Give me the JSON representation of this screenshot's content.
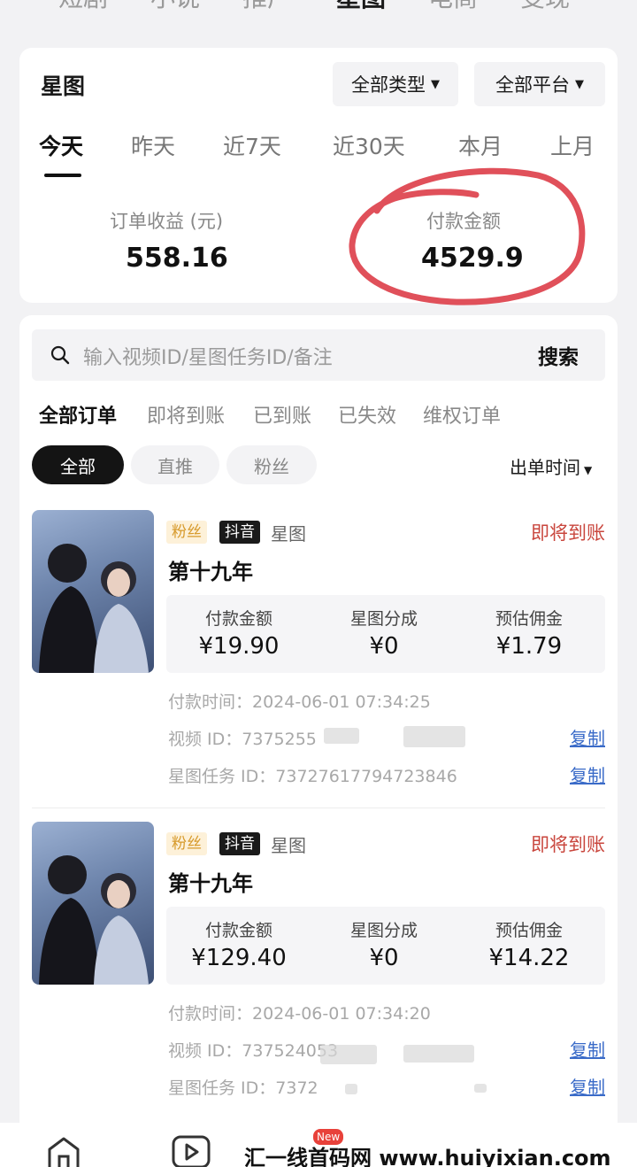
{
  "top_tabs": [
    "短剧",
    "小说",
    "推广",
    "星图",
    "电商",
    "变现"
  ],
  "summary": {
    "title": "星图",
    "filter_type": "全部类型",
    "filter_platform": "全部平台",
    "periods": [
      "今天",
      "昨天",
      "近7天",
      "近30天",
      "本月",
      "上月"
    ],
    "order_income_label": "订单收益 (元)",
    "order_income_value": "558.16",
    "paid_amount_label": "付款金额",
    "paid_amount_value": "4529.9"
  },
  "search": {
    "placeholder": "输入视频ID/星图任务ID/备注",
    "button": "搜索"
  },
  "status_tabs": [
    "全部订单",
    "即将到账",
    "已到账",
    "已失效",
    "维权订单"
  ],
  "chips": [
    "全部",
    "直推",
    "粉丝"
  ],
  "sort_label": "出单时间",
  "orders": [
    {
      "tag_fans": "粉丝",
      "tag_platform": "抖音",
      "source": "星图",
      "status": "即将到账",
      "title": "第十九年",
      "metric_labels": [
        "付款金额",
        "星图分成",
        "预估佣金"
      ],
      "metric_values": [
        "¥19.90",
        "¥0",
        "¥1.79"
      ],
      "pay_time": "付款时间：2024-06-01 07:34:25",
      "video_id": "视频 ID：7375255",
      "task_id": "星图任务 ID：73727617794723846",
      "copy": "复制"
    },
    {
      "tag_fans": "粉丝",
      "tag_platform": "抖音",
      "source": "星图",
      "status": "即将到账",
      "title": "第十九年",
      "metric_labels": [
        "付款金额",
        "星图分成",
        "预估佣金"
      ],
      "metric_values": [
        "¥129.40",
        "¥0",
        "¥14.22"
      ],
      "pay_time": "付款时间：2024-06-01 07:34:20",
      "video_id": "视频 ID：737524053",
      "task_id": "星图任务 ID：7372",
      "copy": "复制"
    }
  ],
  "bottom_nav": {
    "new_badge": "New",
    "watermark": "汇一线首码网 www.huiyixian.com"
  }
}
